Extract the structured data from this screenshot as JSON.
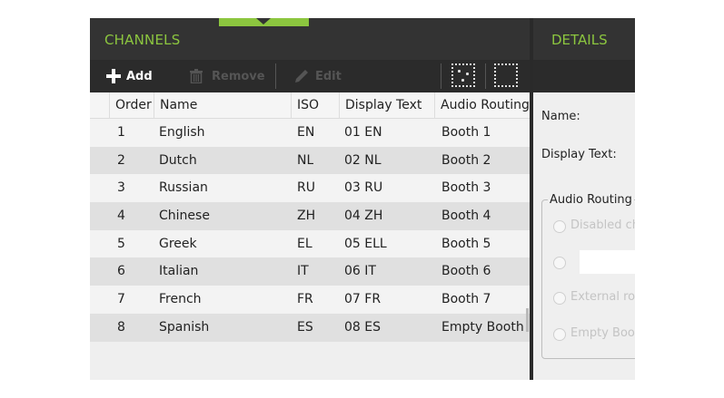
{
  "left_panel": {
    "title": "CHANNELS",
    "toolbar": {
      "add_label": "Add",
      "remove_label": "Remove",
      "edit_label": "Edit"
    },
    "columns": [
      "Order",
      "Name",
      "ISO",
      "Display Text",
      "Audio Routing"
    ],
    "rows": [
      {
        "order": "1",
        "name": "English",
        "iso": "EN",
        "display": "01 EN",
        "routing": "Booth 1"
      },
      {
        "order": "2",
        "name": "Dutch",
        "iso": "NL",
        "display": "02 NL",
        "routing": "Booth 2"
      },
      {
        "order": "3",
        "name": "Russian",
        "iso": "RU",
        "display": "03 RU",
        "routing": "Booth 3"
      },
      {
        "order": "4",
        "name": "Chinese",
        "iso": "ZH",
        "display": "04 ZH",
        "routing": "Booth 4"
      },
      {
        "order": "5",
        "name": "Greek",
        "iso": "EL",
        "display": "05 ELL",
        "routing": "Booth 5"
      },
      {
        "order": "6",
        "name": "Italian",
        "iso": "IT",
        "display": "06 IT",
        "routing": "Booth 6"
      },
      {
        "order": "7",
        "name": "French",
        "iso": "FR",
        "display": "07 FR",
        "routing": "Booth 7"
      },
      {
        "order": "8",
        "name": "Spanish",
        "iso": "ES",
        "display": "08 ES",
        "routing": "Empty Booth"
      }
    ]
  },
  "right_panel": {
    "title": "DETAILS",
    "name_label": "Name:",
    "display_text_label": "Display Text:",
    "audio_routing_title": "Audio Routing",
    "options": [
      "Disabled ch",
      "",
      "External rou",
      "Empty Boot"
    ]
  },
  "colors": {
    "accent": "#8cc63f",
    "header_bg": "#333333",
    "toolbar_bg": "#2b2b2b",
    "row_alt": "#e0e0e0"
  },
  "icons": {
    "add": "plus-icon",
    "remove": "trash-icon",
    "edit": "pencil-icon",
    "select_points": "dotted-select-icon",
    "select_area": "dotted-rect-icon"
  }
}
